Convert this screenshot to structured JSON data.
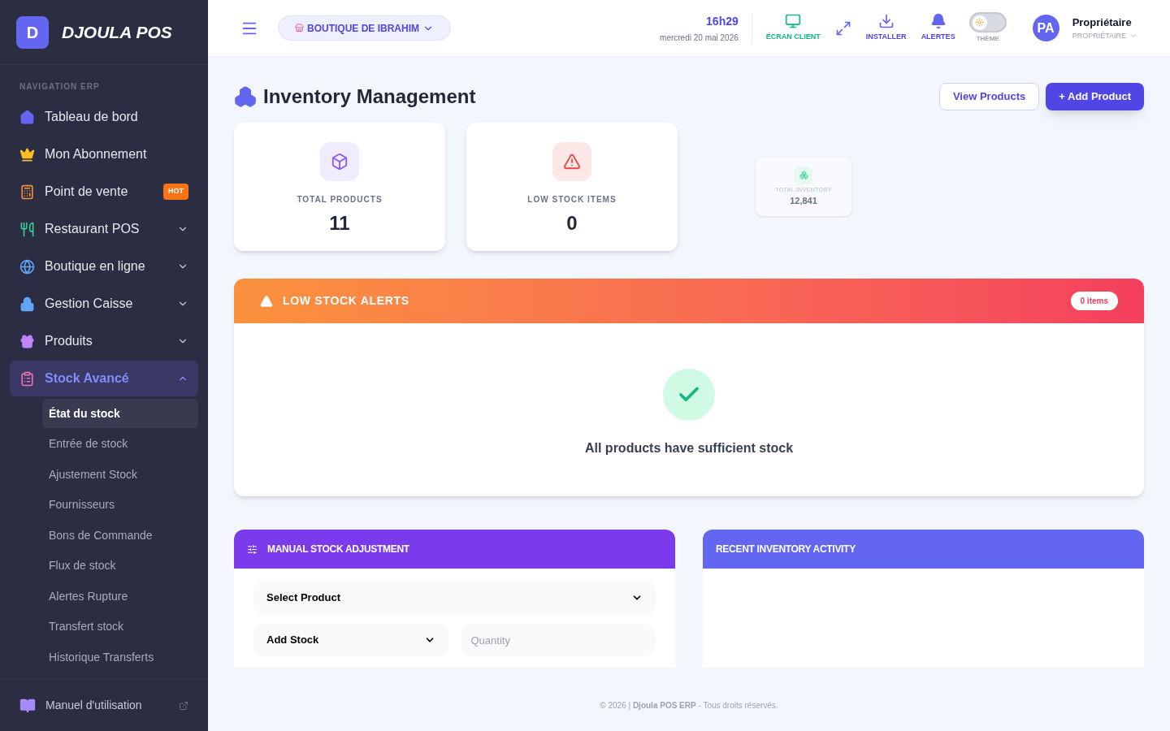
{
  "brand": {
    "letter": "D",
    "name": "DJOULA POS"
  },
  "sidebar": {
    "section_label": "NAVIGATION ERP",
    "items": [
      {
        "label": "Tableau de bord",
        "color": "#6366f1"
      },
      {
        "label": "Mon Abonnement",
        "color": "#fbbf24"
      },
      {
        "label": "Point de vente",
        "color": "#fb923c",
        "badge": "HOT"
      },
      {
        "label": "Restaurant POS",
        "color": "#34d399",
        "expanded": false
      },
      {
        "label": "Boutique en ligne",
        "color": "#60a5fa",
        "expanded": false
      },
      {
        "label": "Gestion Caisse",
        "color": "#60a5fa",
        "expanded": false
      },
      {
        "label": "Produits",
        "color": "#c084fc",
        "expanded": false
      },
      {
        "label": "Stock Avancé",
        "color": "#f472b6",
        "expanded": true,
        "children": [
          {
            "label": "État du stock",
            "selected": true
          },
          {
            "label": "Entrée de stock",
            "selected": false
          },
          {
            "label": "Ajustement Stock",
            "selected": false
          },
          {
            "label": "Fournisseurs",
            "selected": false
          },
          {
            "label": "Bons de Commande",
            "selected": false
          },
          {
            "label": "Flux de stock",
            "selected": false
          },
          {
            "label": "Alertes Rupture",
            "selected": false
          },
          {
            "label": "Transfert stock",
            "selected": false
          },
          {
            "label": "Historique Transferts",
            "selected": false
          }
        ]
      }
    ],
    "footer_link": "Manuel d'utilisation"
  },
  "topbar": {
    "store": "BOUTIQUE DE IBRAHIM",
    "time": "16h29",
    "date": "mercredi 20 mai 2026",
    "actions": [
      {
        "label": "ÉCRAN CLIENT"
      },
      {
        "label": "INSTALLER"
      },
      {
        "label": "ALERTES"
      }
    ],
    "theme": {
      "label": "THÈME",
      "on": false
    },
    "user": {
      "initials": "PA",
      "name": "Propriétaire",
      "role": "PROPRIÉTAIRE"
    }
  },
  "page": {
    "title": "Inventory Management",
    "buttons": [
      {
        "label": "View Products",
        "kind": "outline"
      },
      {
        "label": "+ Add Product",
        "kind": "primary"
      }
    ]
  },
  "stats": [
    {
      "label": "TOTAL PRODUCTS",
      "value": "11"
    },
    {
      "label": "LOW STOCK ITEMS",
      "value": "0"
    },
    {
      "label": "TOTAL INVENTORY",
      "value": "12,841"
    }
  ],
  "alerts": {
    "title": "LOW STOCK ALERTS",
    "count": "0 items",
    "message": "All products have sufficient stock"
  },
  "adjustment": {
    "title": "MANUAL STOCK ADJUSTMENT",
    "product_select": "Select Product",
    "type_select": "Add Stock",
    "quantity_placeholder": "Quantity"
  },
  "activity": {
    "title": "RECENT INVENTORY ACTIVITY"
  },
  "footer": {
    "text": "© 2026 | **Djoula POS ERP** - Tous droits réservés."
  }
}
